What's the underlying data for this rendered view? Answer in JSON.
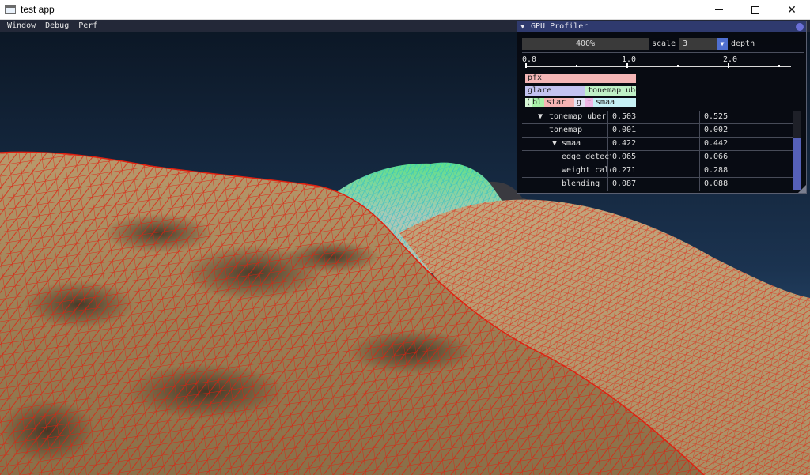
{
  "window": {
    "title": "test app",
    "minimize_icon": "minimize-icon",
    "maximize_icon": "maximize-icon",
    "close_icon": "close-icon"
  },
  "menu": {
    "items": [
      "Window",
      "Debug",
      "Perf"
    ]
  },
  "profiler": {
    "title": "GPU Profiler",
    "scale_value": "400%",
    "scale_label": "scale",
    "depth_value": "3",
    "depth_label": "depth",
    "ruler_labels": [
      "0.0",
      "1.0",
      "2.0"
    ],
    "bars": [
      {
        "label": "pfx",
        "color": "#f4b6b6"
      },
      {
        "label": "glare",
        "color": "#c3c3f0"
      },
      {
        "label": "tonemap uber",
        "color": "#bff0c6"
      },
      {
        "label": "(",
        "color": "#d7f7d7"
      },
      {
        "label": "bl",
        "color": "#a8f0a8"
      },
      {
        "label": "star",
        "color": "#f6b4b4"
      },
      {
        "label": "g",
        "color": "#e4e4f4"
      },
      {
        "label": "t",
        "color": "#f0b8e6"
      },
      {
        "label": "smaa",
        "color": "#c6f1f5"
      }
    ],
    "rows": [
      {
        "name": "tonemap uber",
        "expander": "▼",
        "v1": "0.503",
        "v2": "0.525"
      },
      {
        "name": "tonemap",
        "expander": "",
        "v1": "0.001",
        "v2": "0.002"
      },
      {
        "name": "smaa",
        "expander": "▼",
        "v1": "0.422",
        "v2": "0.442"
      },
      {
        "name": "edge detect",
        "expander": "",
        "v1": "0.065",
        "v2": "0.066"
      },
      {
        "name": "weight calc",
        "expander": "",
        "v1": "0.271",
        "v2": "0.288"
      },
      {
        "name": "blending",
        "expander": "",
        "v1": "0.087",
        "v2": "0.088"
      }
    ]
  },
  "colors": {
    "sky_top": "#0b1624",
    "sky_bottom": "#2f5a85",
    "terrain": "#b99a6c",
    "wireframe_near": "#e02010",
    "wireframe_far_top": "#22e080",
    "wireframe_far_body": "#2ec0c8",
    "accent": "#4f6fd0"
  }
}
